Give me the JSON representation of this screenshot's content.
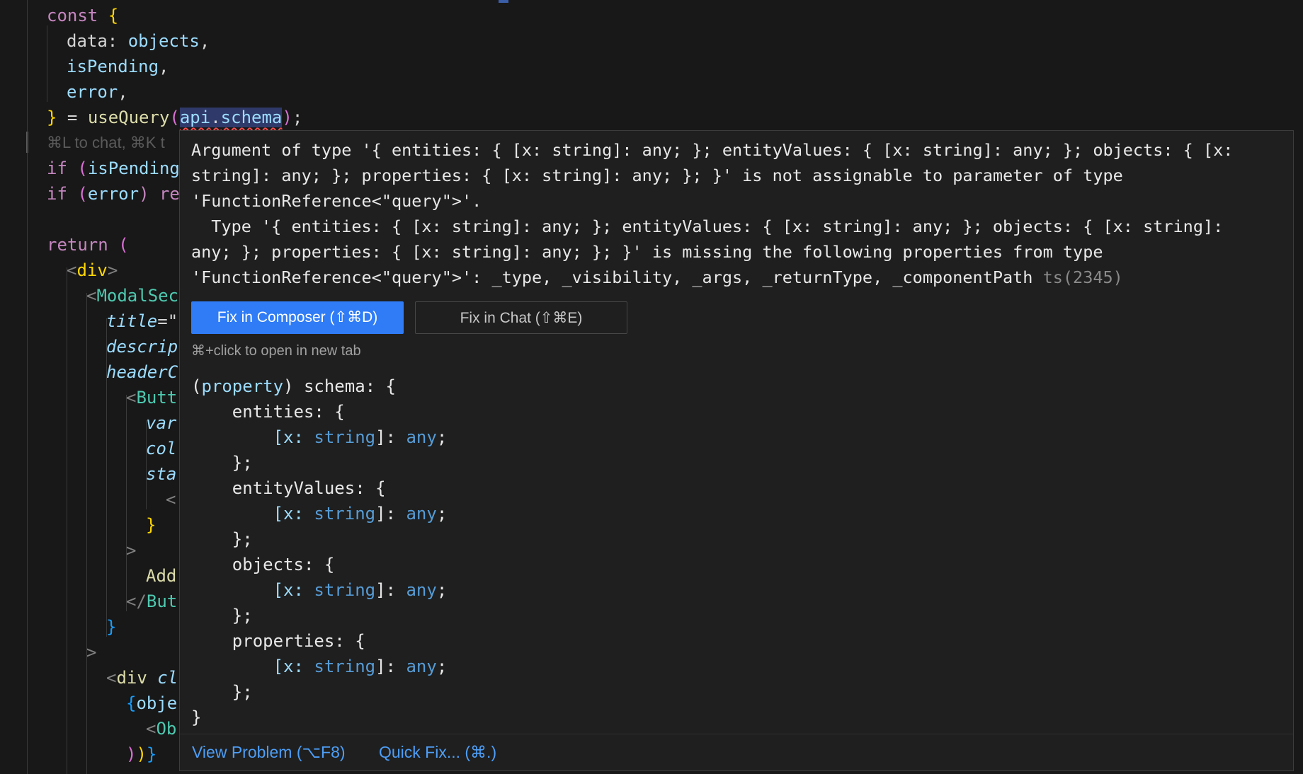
{
  "editor": {
    "lines": [
      [
        "const ",
        "{"
      ],
      [
        "data: ",
        "objects",
        ","
      ],
      [
        "isPending",
        ","
      ],
      [
        "error",
        ","
      ],
      [
        "} = ",
        "useQuery",
        "(",
        "api",
        ".",
        "schema",
        ")",
        ";"
      ],
      [
        "⌘L to chat, ⌘K t"
      ],
      [
        "if ",
        "(",
        "isPending"
      ],
      [
        "if ",
        "(",
        "error",
        ") re"
      ],
      [],
      [
        "return ",
        "("
      ],
      [
        "<",
        "div",
        ">"
      ],
      [
        "<",
        "ModalSec"
      ],
      [
        "title",
        "=\""
      ],
      [
        "descrip"
      ],
      [
        "headerC"
      ],
      [
        "<",
        "Butt"
      ],
      [
        "var"
      ],
      [
        "col"
      ],
      [
        "sta"
      ],
      [
        "<"
      ],
      [
        "}"
      ],
      [
        ">"
      ],
      [
        "Add"
      ],
      [
        "</",
        "But"
      ],
      [
        "}"
      ],
      [
        ">"
      ],
      [
        "<",
        "div ",
        "cl"
      ],
      [
        "{",
        "obje"
      ],
      [
        "<",
        "Ob"
      ],
      [
        ")",
        ")",
        "}"
      ]
    ]
  },
  "hover": {
    "message_lines": [
      "Argument of type '{ entities: { [x: string]: any; }; entityValues: { [x: string]: any; }; objects: { [x:",
      "string]: any; }; properties: { [x: string]: any; }; }' is not assignable to parameter of type",
      "'FunctionReference<\"query\">'.",
      "  Type '{ entities: { [x: string]: any; }; entityValues: { [x: string]: any; }; objects: { [x: string]:",
      "any; }; properties: { [x: string]: any; }; }' is missing the following properties from type",
      "'FunctionReference<\"query\">': _type, _visibility, _args, _returnType, _componentPath "
    ],
    "error_code": "ts(2345)",
    "fix_composer_label": "Fix in Composer (⇧⌘D)",
    "fix_chat_label": "Fix in Chat (⇧⌘E)",
    "open_tab_hint": "⌘+click to open in new tab",
    "signature": {
      "keyword": "property",
      "name": "schema",
      "fields": [
        "entities",
        "entityValues",
        "objects",
        "properties"
      ],
      "index_key": "x",
      "index_type": "string",
      "value_type": "any"
    },
    "view_problem_label": "View Problem (⌥F8)",
    "quick_fix_label": "Quick Fix... (⌘.)"
  }
}
